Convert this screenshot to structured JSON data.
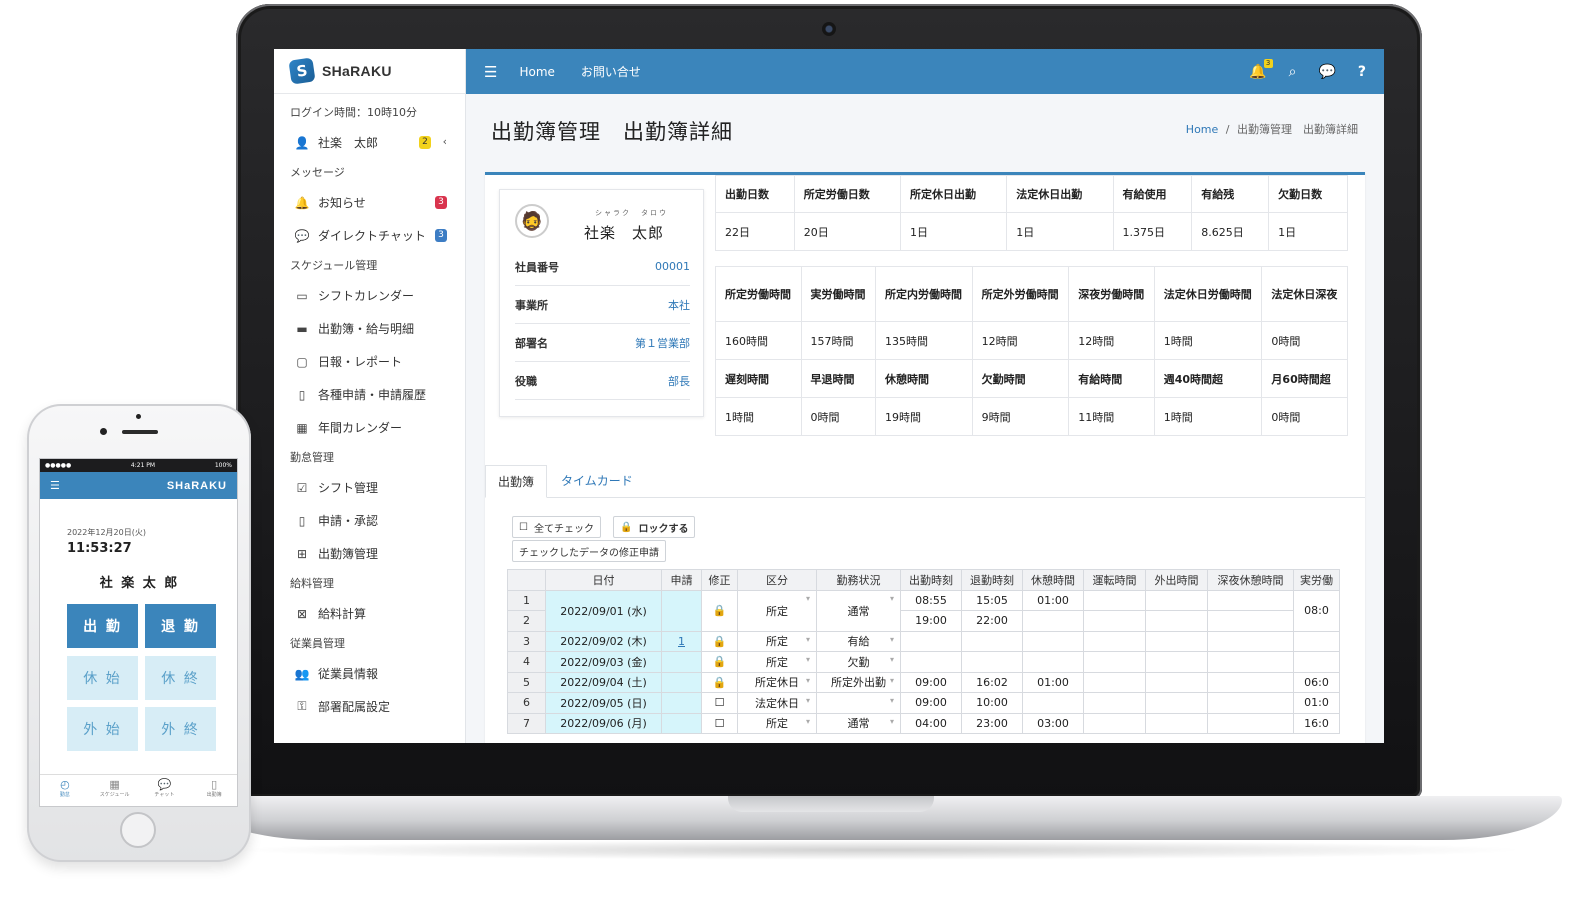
{
  "sidebar": {
    "brand": "SHaRAKU",
    "login_time": "ログイン時間：10時10分",
    "user": {
      "name": "社楽　太郎",
      "badge": "2"
    },
    "sections": [
      {
        "title": "メッセージ",
        "items": [
          {
            "icon": "bell-icon",
            "glyph": "🔔",
            "label": "お知らせ",
            "badge": "3",
            "badge_color": "#d9344e"
          },
          {
            "icon": "chat-icon",
            "glyph": "💬",
            "label": "ダイレクトチャット",
            "badge": "3",
            "badge_color": "#3d7dc4"
          }
        ]
      },
      {
        "title": "スケジュール管理",
        "items": [
          {
            "icon": "calendar-icon",
            "glyph": "▭",
            "label": "シフトカレンダー"
          },
          {
            "icon": "card-icon",
            "glyph": "▬",
            "label": "出勤簿・給与明細"
          },
          {
            "icon": "note-icon",
            "glyph": "▢",
            "label": "日報・レポート"
          },
          {
            "icon": "file-icon",
            "glyph": "▯",
            "label": "各種申請・申請履歴"
          },
          {
            "icon": "calendar-grid-icon",
            "glyph": "▦",
            "label": "年間カレンダー"
          }
        ]
      },
      {
        "title": "勤怠管理",
        "items": [
          {
            "icon": "calendar-check-icon",
            "glyph": "☑",
            "label": "シフト管理"
          },
          {
            "icon": "clipboard-icon",
            "glyph": "▯",
            "label": "申請・承認"
          },
          {
            "icon": "calendar-plus-icon",
            "glyph": "⊞",
            "label": "出勤簿管理"
          }
        ]
      },
      {
        "title": "給料管理",
        "items": [
          {
            "icon": "calendar-times-icon",
            "glyph": "⊠",
            "label": "給料計算"
          }
        ]
      },
      {
        "title": "従業員管理",
        "items": [
          {
            "icon": "users-icon",
            "glyph": "👥",
            "label": "従業員情報"
          },
          {
            "icon": "sitemap-icon",
            "glyph": "⚿",
            "label": "部署配属設定"
          }
        ]
      }
    ]
  },
  "topbar": {
    "nav": [
      "Home",
      "お問い合せ"
    ],
    "bell_badge": "3"
  },
  "page": {
    "title": "出勤簿管理　出勤簿詳細",
    "breadcrumb": {
      "home": "Home",
      "sep": "/",
      "rest": "出勤簿管理　出勤簿詳細"
    }
  },
  "profile": {
    "ruby": [
      "シャラク",
      "タロウ"
    ],
    "name": "社楽　太郎",
    "rows": [
      {
        "label": "社員番号",
        "value": "00001"
      },
      {
        "label": "事業所",
        "value": "本社"
      },
      {
        "label": "部署名",
        "value": "第１営業部"
      },
      {
        "label": "役職",
        "value": "部長"
      }
    ]
  },
  "summary1": {
    "headers": [
      "出勤日数",
      "所定労働日数",
      "所定休日出勤",
      "法定休日出勤",
      "有給使用",
      "有給残",
      "欠勤日数"
    ],
    "values": [
      "22日",
      "20日",
      "1日",
      "1日",
      "1.375日",
      "8.625日",
      "1日"
    ]
  },
  "summary2": {
    "headers": [
      "所定労働時間",
      "実労働時間",
      "所定内労働時間",
      "所定外労働時間",
      "深夜労働時間",
      "法定休日労働時間",
      "法定休日深夜"
    ],
    "values": [
      "160時間",
      "157時間",
      "135時間",
      "12時間",
      "12時間",
      "1時間",
      "0時間"
    ],
    "headers2": [
      "遅刻時間",
      "早退時間",
      "休憩時間",
      "欠勤時間",
      "有給時間",
      "週40時間超",
      "月60時間超"
    ],
    "values2": [
      "1時間",
      "0時間",
      "19時間",
      "9時間",
      "11時間",
      "1時間",
      "0時間"
    ]
  },
  "tabs": [
    "出勤簿",
    "タイムカード"
  ],
  "toolbar": {
    "check_all": "全てチェック",
    "lock": "ロックする",
    "fix_request": "チェックしたデータの修正申請"
  },
  "grid": {
    "headers": [
      "",
      "日付",
      "申請",
      "修正",
      "区分",
      "勤務状況",
      "出勤時刻",
      "退勤時刻",
      "休憩時間",
      "運転時間",
      "外出時間",
      "深夜休憩時間",
      "実労働"
    ],
    "rows": [
      {
        "n": [
          "1",
          "2"
        ],
        "date": "2022/09/01 (水)",
        "req": "",
        "lock": true,
        "kubun": "所定",
        "status": "通常",
        "in": [
          "08:55",
          "19:00"
        ],
        "out": [
          "15:05",
          "22:00"
        ],
        "brk": [
          "01:00",
          ""
        ],
        "work": "08:0"
      },
      {
        "n": [
          "3"
        ],
        "date": "2022/09/02 (木)",
        "req": "1",
        "lock": true,
        "kubun": "所定",
        "status": "有給",
        "in": [
          ""
        ],
        "out": [
          ""
        ],
        "brk": [
          ""
        ],
        "work": ""
      },
      {
        "n": [
          "4"
        ],
        "date": "2022/09/03 (金)",
        "req": "",
        "lock": true,
        "kubun": "所定",
        "status": "欠勤",
        "in": [
          ""
        ],
        "out": [
          ""
        ],
        "brk": [
          ""
        ],
        "work": ""
      },
      {
        "n": [
          "5"
        ],
        "date": "2022/09/04 (土)",
        "req": "",
        "lock": true,
        "kubun": "所定休日",
        "status": "所定外出勤",
        "in": [
          "09:00"
        ],
        "out": [
          "16:02"
        ],
        "brk": [
          "01:00"
        ],
        "work": "06:0"
      },
      {
        "n": [
          "6"
        ],
        "date": "2022/09/05 (日)",
        "req": "",
        "lock": false,
        "kubun": "法定休日",
        "status": "",
        "in": [
          "09:00"
        ],
        "out": [
          "10:00"
        ],
        "brk": [
          ""
        ],
        "work": "01:0"
      },
      {
        "n": [
          "7"
        ],
        "date": "2022/09/06 (月)",
        "req": "",
        "lock": false,
        "kubun": "所定",
        "status": "通常",
        "in": [
          "04:00"
        ],
        "out": [
          "23:00"
        ],
        "brk": [
          "03:00"
        ],
        "work": "16:0"
      }
    ]
  },
  "phone": {
    "status_left": "●●●●● ",
    "status_time": "4:21 PM",
    "status_right": "100%",
    "brand": "SHaRAKU",
    "date": "2022年12月20日(火)",
    "time": "11:53:27",
    "name": "社 楽  太 郎",
    "buttons": [
      "出 勤",
      "退 勤",
      "休 始",
      "休 終",
      "外 始",
      "外 終"
    ],
    "tabs": [
      {
        "icon": "clock-icon",
        "glyph": "◴",
        "label": "勤怠"
      },
      {
        "icon": "schedule-icon",
        "glyph": "▦",
        "label": "スケジュール"
      },
      {
        "icon": "chat-icon",
        "glyph": "💬",
        "label": "チャット"
      },
      {
        "icon": "book-icon",
        "glyph": "▯",
        "label": "出勤簿"
      }
    ]
  }
}
